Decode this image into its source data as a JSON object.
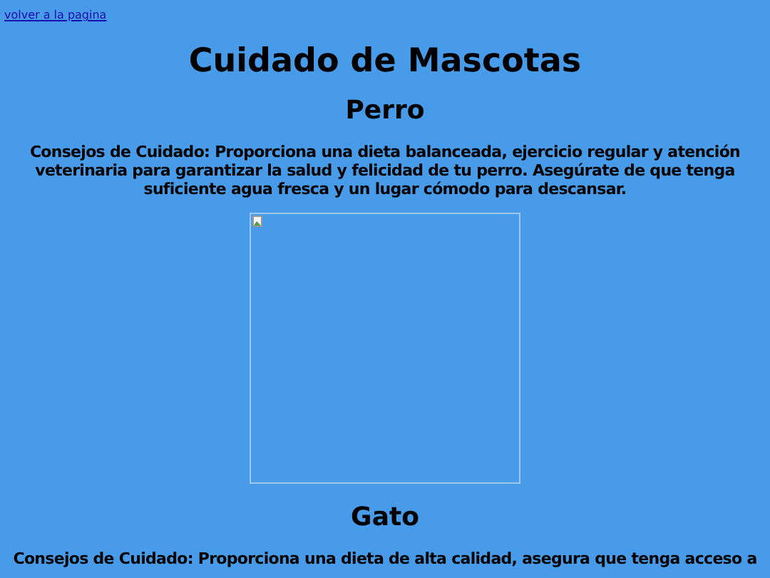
{
  "back_link": "volver a la pagina",
  "title": "Cuidado de Mascotas",
  "sections": [
    {
      "heading": "Perro",
      "text": "Consejos de Cuidado: Proporciona una dieta balanceada, ejercicio regular y atención veterinaria para garantizar la salud y felicidad de tu perro. Asegúrate de que tenga suficiente agua fresca y un lugar cómodo para descansar.",
      "image": {
        "kind": "broken"
      }
    },
    {
      "heading": "Gato",
      "text": "Consejos de Cuidado: Proporciona una dieta de alta calidad, asegura que tenga acceso a"
    }
  ]
}
